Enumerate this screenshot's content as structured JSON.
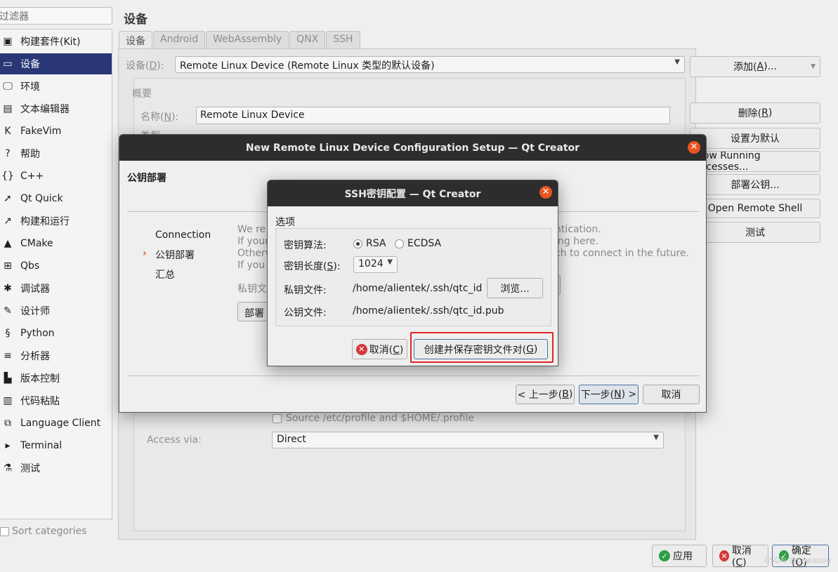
{
  "sidebar": {
    "filter_placeholder": "过滤器",
    "items": [
      {
        "label": "构建套件(Kit)",
        "icon": "kit-icon",
        "glyph": "▣"
      },
      {
        "label": "设备",
        "icon": "device-icon",
        "glyph": "▭"
      },
      {
        "label": "环境",
        "icon": "monitor-icon",
        "glyph": "🖵"
      },
      {
        "label": "文本编辑器",
        "icon": "text-editor-icon",
        "glyph": "▤"
      },
      {
        "label": "FakeVim",
        "icon": "fakevim-icon",
        "glyph": "K"
      },
      {
        "label": "帮助",
        "icon": "help-icon",
        "glyph": "?"
      },
      {
        "label": "C++",
        "icon": "cpp-icon",
        "glyph": "{}"
      },
      {
        "label": "Qt Quick",
        "icon": "qtquick-icon",
        "glyph": "➚"
      },
      {
        "label": "构建和运行",
        "icon": "build-run-icon",
        "glyph": "↗"
      },
      {
        "label": "CMake",
        "icon": "cmake-icon",
        "glyph": "▲"
      },
      {
        "label": "Qbs",
        "icon": "qbs-icon",
        "glyph": "⊞"
      },
      {
        "label": "调试器",
        "icon": "debugger-bug-icon",
        "glyph": "✱"
      },
      {
        "label": "设计师",
        "icon": "designer-pen-icon",
        "glyph": "✎"
      },
      {
        "label": "Python",
        "icon": "python-icon",
        "glyph": "§"
      },
      {
        "label": "分析器",
        "icon": "analyzer-icon",
        "glyph": "≡"
      },
      {
        "label": "版本控制",
        "icon": "version-control-icon",
        "glyph": "▙"
      },
      {
        "label": "代码粘贴",
        "icon": "code-paste-icon",
        "glyph": "▥"
      },
      {
        "label": "Language Client",
        "icon": "language-client-icon",
        "glyph": "⧉"
      },
      {
        "label": "Terminal",
        "icon": "terminal-icon",
        "glyph": "▸"
      },
      {
        "label": "测试",
        "icon": "test-icon",
        "glyph": "⚗"
      }
    ],
    "active_index": 1,
    "sort_categories": "Sort categories"
  },
  "main": {
    "title": "设备",
    "tabs": [
      "设备",
      "Android",
      "WebAssembly",
      "QNX",
      "SSH"
    ],
    "device_label": "设备(",
    "device_mnemonic": "D",
    "device_label_end": "):",
    "device_value": "Remote Linux Device (Remote Linux 类型的默认设备)",
    "overview_title": "概要",
    "name_label": "名称(",
    "name_mnemonic": "N",
    "name_label_end": "):",
    "name_value": "Remote Linux Device",
    "type_label_partial": "类型",
    "source_profile": "Source /etc/profile and $HOME/.profile",
    "access_via_label": "Access via:",
    "access_via_value": "Direct"
  },
  "right_buttons": {
    "add": "添加(",
    "add_mn": "A",
    "add_end": ")...",
    "remove": "删除(",
    "remove_mn": "R",
    "remove_end": ")",
    "set_default": "设置为默认",
    "show_processes": "Show Running Processes...",
    "deploy_key": "部署公钥...",
    "open_shell": "Open Remote Shell",
    "test": "测试"
  },
  "bottom_buttons": {
    "apply": "应用",
    "cancel": "取消(",
    "cancel_mn": "C",
    "cancel_end": ")",
    "ok": "确定(",
    "ok_mn": "O",
    "ok_end": ")"
  },
  "wizard": {
    "title": "New Remote Linux Device Configuration Setup — Qt Creator",
    "page_title": "公钥部署",
    "steps": [
      "Connection",
      "公钥部署",
      "汇总"
    ],
    "current_step": 1,
    "text_lines": [
      "We re",
      "If your",
      "Otherw",
      "If you"
    ],
    "text_right": [
      "ntication.",
      "ing here.",
      "ch to connect in the future."
    ],
    "private_key_partial": "私钥文",
    "deploy_btn_partial": "部署",
    "back": "< 上一步(",
    "back_mn": "B",
    "back_end": ")",
    "next": "下一步(",
    "next_mn": "N",
    "next_end": ") >",
    "cancel": "取消"
  },
  "ssh_dialog": {
    "title": "SSH密钥配置 — Qt Creator",
    "group_title": "选项",
    "algo_label": "密钥算法:",
    "algo_options": [
      "RSA",
      "ECDSA"
    ],
    "algo_selected": "RSA",
    "length_label": "密钥长度(",
    "length_mn": "S",
    "length_end": "):",
    "length_value": "1024",
    "private_label": "私钥文件:",
    "private_value": "/home/alientek/.ssh/qtc_id",
    "browse": "浏览...",
    "public_label": "公钥文件:",
    "public_value": "/home/alientek/.ssh/qtc_id.pub",
    "cancel": "取消(",
    "cancel_mn": "C",
    "cancel_end": ")",
    "create": "创建并保存密钥文件对(",
    "create_mn": "G",
    "create_end": ")"
  },
  "watermark": "CSDN @bowazou",
  "colors": {
    "accent": "#2a3676",
    "close_button": "#e95420",
    "highlight": "#e02424",
    "titlebar": "#2d2d2d"
  }
}
